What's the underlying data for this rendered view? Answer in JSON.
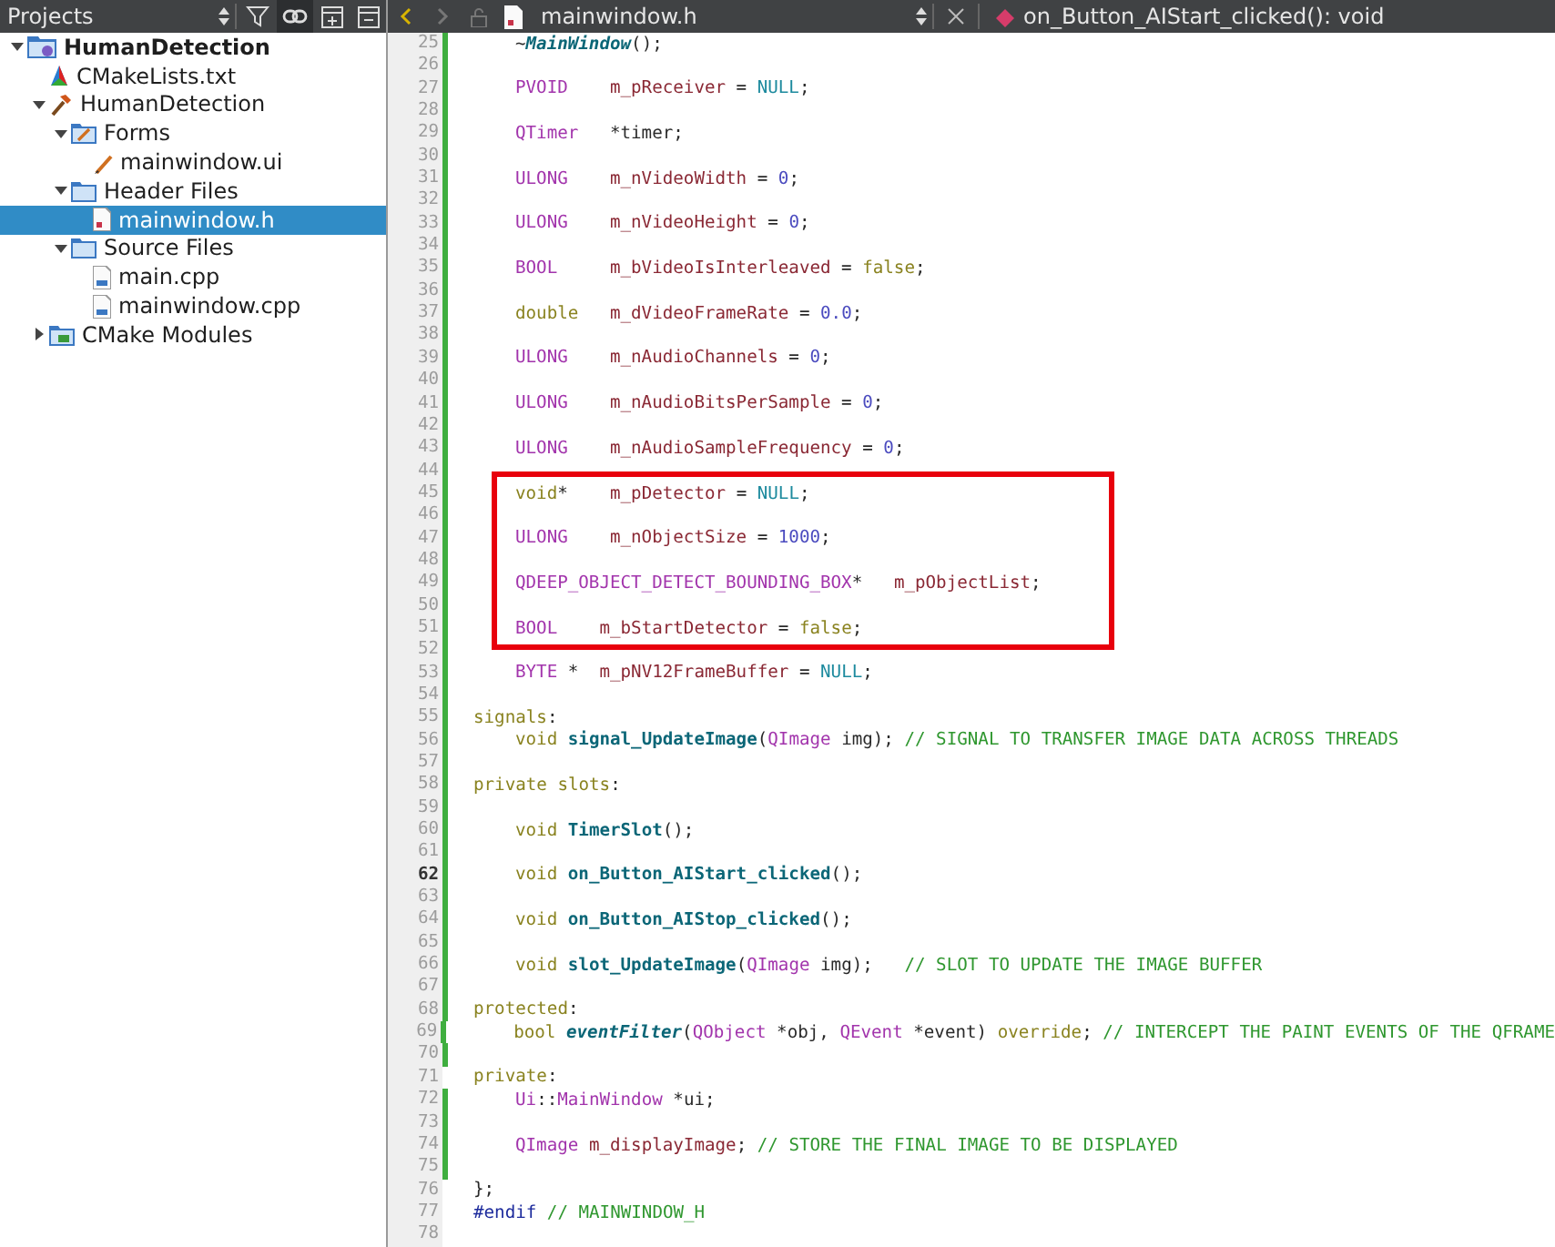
{
  "sidebar": {
    "title": "Projects",
    "tree": [
      {
        "label": "HumanDetection",
        "kind": "project",
        "expanded": true,
        "selected": false,
        "children": [
          {
            "label": "CMakeLists.txt",
            "kind": "cmake",
            "selected": false
          },
          {
            "label": "HumanDetection",
            "kind": "build",
            "expanded": true,
            "selected": false,
            "children": [
              {
                "label": "Forms",
                "kind": "forms-folder",
                "expanded": true,
                "selected": false,
                "children": [
                  {
                    "label": "mainwindow.ui",
                    "kind": "form",
                    "selected": false
                  }
                ]
              },
              {
                "label": "Header Files",
                "kind": "header-folder",
                "expanded": true,
                "selected": false,
                "children": [
                  {
                    "label": "mainwindow.h",
                    "kind": "header",
                    "selected": true
                  }
                ]
              },
              {
                "label": "Source Files",
                "kind": "source-folder",
                "expanded": true,
                "selected": false,
                "children": [
                  {
                    "label": "main.cpp",
                    "kind": "source",
                    "selected": false
                  },
                  {
                    "label": "mainwindow.cpp",
                    "kind": "source",
                    "selected": false
                  }
                ]
              }
            ]
          },
          {
            "label": "CMake Modules",
            "kind": "modules-folder",
            "expanded": false,
            "selected": false
          }
        ]
      }
    ]
  },
  "editor": {
    "file_name": "mainwindow.h",
    "symbol": "on_Button_AIStart_clicked(): void",
    "lines": [
      {
        "kind": "body",
        "n": "25",
        "modified": true,
        "current": false,
        "tokens": [
          {
            "text": "~",
            "kind": "plain"
          },
          {
            "text": "MainWindow",
            "kind": "italic"
          },
          {
            "text": "();",
            "kind": "plain"
          }
        ]
      },
      {
        "kind": "blank",
        "n": "26",
        "modified": true,
        "current": false
      },
      {
        "kind": "body",
        "n": "27",
        "modified": true,
        "current": false,
        "tokens": [
          {
            "text": "PVOID    ",
            "kind": "type"
          },
          {
            "text": "m_pReceiver",
            "kind": "member"
          },
          {
            "text": " = ",
            "kind": "plain"
          },
          {
            "text": "NULL",
            "kind": "constant"
          },
          {
            "text": ";",
            "kind": "plain"
          }
        ]
      },
      {
        "kind": "blank",
        "n": "28",
        "modified": true,
        "current": false
      },
      {
        "kind": "body",
        "n": "29",
        "modified": true,
        "current": false,
        "tokens": [
          {
            "text": "QTimer   ",
            "kind": "type"
          },
          {
            "text": "*timer;",
            "kind": "plain"
          }
        ]
      },
      {
        "kind": "blank",
        "n": "30",
        "modified": true,
        "current": false
      },
      {
        "kind": "body",
        "n": "31",
        "modified": true,
        "current": false,
        "tokens": [
          {
            "text": "ULONG    ",
            "kind": "type"
          },
          {
            "text": "m_nVideoWidth",
            "kind": "member"
          },
          {
            "text": " = ",
            "kind": "plain"
          },
          {
            "text": "0",
            "kind": "number"
          },
          {
            "text": ";",
            "kind": "plain"
          }
        ]
      },
      {
        "kind": "blank",
        "n": "32",
        "modified": true,
        "current": false
      },
      {
        "kind": "body",
        "n": "33",
        "modified": true,
        "current": false,
        "tokens": [
          {
            "text": "ULONG    ",
            "kind": "type"
          },
          {
            "text": "m_nVideoHeight",
            "kind": "member"
          },
          {
            "text": " = ",
            "kind": "plain"
          },
          {
            "text": "0",
            "kind": "number"
          },
          {
            "text": ";",
            "kind": "plain"
          }
        ]
      },
      {
        "kind": "blank",
        "n": "34",
        "modified": true,
        "current": false
      },
      {
        "kind": "body",
        "n": "35",
        "modified": true,
        "current": false,
        "tokens": [
          {
            "text": "BOOL     ",
            "kind": "type"
          },
          {
            "text": "m_bVideoIsInterleaved",
            "kind": "member"
          },
          {
            "text": " = ",
            "kind": "plain"
          },
          {
            "text": "false",
            "kind": "keyword"
          },
          {
            "text": ";",
            "kind": "plain"
          }
        ]
      },
      {
        "kind": "blank",
        "n": "36",
        "modified": true,
        "current": false
      },
      {
        "kind": "body",
        "n": "37",
        "modified": true,
        "current": false,
        "tokens": [
          {
            "text": "double   ",
            "kind": "keyword"
          },
          {
            "text": "m_dVideoFrameRate",
            "kind": "member"
          },
          {
            "text": " = ",
            "kind": "plain"
          },
          {
            "text": "0.0",
            "kind": "number"
          },
          {
            "text": ";",
            "kind": "plain"
          }
        ]
      },
      {
        "kind": "blank",
        "n": "38",
        "modified": true,
        "current": false
      },
      {
        "kind": "body",
        "n": "39",
        "modified": true,
        "current": false,
        "tokens": [
          {
            "text": "ULONG    ",
            "kind": "type"
          },
          {
            "text": "m_nAudioChannels",
            "kind": "member"
          },
          {
            "text": " = ",
            "kind": "plain"
          },
          {
            "text": "0",
            "kind": "number"
          },
          {
            "text": ";",
            "kind": "plain"
          }
        ]
      },
      {
        "kind": "blank",
        "n": "40",
        "modified": true,
        "current": false
      },
      {
        "kind": "body",
        "n": "41",
        "modified": true,
        "current": false,
        "tokens": [
          {
            "text": "ULONG    ",
            "kind": "type"
          },
          {
            "text": "m_nAudioBitsPerSample",
            "kind": "member"
          },
          {
            "text": " = ",
            "kind": "plain"
          },
          {
            "text": "0",
            "kind": "number"
          },
          {
            "text": ";",
            "kind": "plain"
          }
        ]
      },
      {
        "kind": "blank",
        "n": "42",
        "modified": true,
        "current": false
      },
      {
        "kind": "body",
        "n": "43",
        "modified": true,
        "current": false,
        "tokens": [
          {
            "text": "ULONG    ",
            "kind": "type"
          },
          {
            "text": "m_nAudioSampleFrequency",
            "kind": "member"
          },
          {
            "text": " = ",
            "kind": "plain"
          },
          {
            "text": "0",
            "kind": "number"
          },
          {
            "text": ";",
            "kind": "plain"
          }
        ]
      },
      {
        "kind": "blank",
        "n": "44",
        "modified": true,
        "current": false
      },
      {
        "kind": "highlight",
        "children": [
          {
            "kind": "body",
            "n": "45",
            "modified": true,
            "current": false,
            "tokens": [
              {
                "text": "void",
                "kind": "keyword"
              },
              {
                "text": "*    ",
                "kind": "plain"
              },
              {
                "text": "m_pDetector",
                "kind": "member"
              },
              {
                "text": " = ",
                "kind": "plain"
              },
              {
                "text": "NULL",
                "kind": "constant"
              },
              {
                "text": ";",
                "kind": "plain"
              }
            ]
          },
          {
            "kind": "blank",
            "n": "46",
            "modified": true,
            "current": false
          },
          {
            "kind": "body",
            "n": "47",
            "modified": true,
            "current": false,
            "tokens": [
              {
                "text": "ULONG    ",
                "kind": "type"
              },
              {
                "text": "m_nObjectSize",
                "kind": "member"
              },
              {
                "text": " = ",
                "kind": "plain"
              },
              {
                "text": "1000",
                "kind": "number"
              },
              {
                "text": ";",
                "kind": "plain"
              }
            ]
          },
          {
            "kind": "blank",
            "n": "48",
            "modified": true,
            "current": false
          },
          {
            "kind": "body",
            "n": "49",
            "modified": true,
            "current": false,
            "tokens": [
              {
                "text": "QDEEP_OBJECT_DETECT_BOUNDING_BOX",
                "kind": "type"
              },
              {
                "text": "*   ",
                "kind": "plain"
              },
              {
                "text": "m_pObjectList",
                "kind": "member"
              },
              {
                "text": ";",
                "kind": "plain"
              }
            ]
          },
          {
            "kind": "blank",
            "n": "50",
            "modified": true,
            "current": false
          },
          {
            "kind": "body",
            "n": "51",
            "modified": true,
            "current": false,
            "tokens": [
              {
                "text": "BOOL    ",
                "kind": "type"
              },
              {
                "text": "m_bStartDetector",
                "kind": "member"
              },
              {
                "text": " = ",
                "kind": "plain"
              },
              {
                "text": "false",
                "kind": "keyword"
              },
              {
                "text": ";",
                "kind": "plain"
              }
            ]
          }
        ]
      },
      {
        "kind": "blank",
        "n": "52",
        "modified": true,
        "current": false
      },
      {
        "kind": "body",
        "n": "53",
        "modified": true,
        "current": false,
        "tokens": [
          {
            "text": "BYTE ",
            "kind": "type"
          },
          {
            "text": "*  ",
            "kind": "plain"
          },
          {
            "text": "m_pNV12FrameBuffer",
            "kind": "member"
          },
          {
            "text": " = ",
            "kind": "plain"
          },
          {
            "text": "NULL",
            "kind": "constant"
          },
          {
            "text": ";",
            "kind": "plain"
          }
        ]
      },
      {
        "kind": "blank",
        "n": "54",
        "modified": true,
        "current": false
      },
      {
        "kind": "label",
        "n": "55",
        "modified": true,
        "current": false,
        "tokens": [
          {
            "text": "signals",
            "kind": "keyword"
          },
          {
            "text": ":",
            "kind": "plain"
          }
        ]
      },
      {
        "kind": "body",
        "n": "56",
        "modified": true,
        "current": false,
        "tokens": [
          {
            "text": "void ",
            "kind": "keyword"
          },
          {
            "text": "signal_UpdateImage",
            "kind": "function"
          },
          {
            "text": "(",
            "kind": "plain"
          },
          {
            "text": "QImage",
            "kind": "type"
          },
          {
            "text": " img); ",
            "kind": "plain"
          },
          {
            "text": "// SIGNAL TO TRANSFER IMAGE DATA ACROSS THREADS",
            "kind": "comment"
          }
        ]
      },
      {
        "kind": "blank",
        "n": "57",
        "modified": true,
        "current": false
      },
      {
        "kind": "label",
        "n": "58",
        "modified": true,
        "current": false,
        "tokens": [
          {
            "text": "private slots",
            "kind": "keyword"
          },
          {
            "text": ":",
            "kind": "plain"
          }
        ]
      },
      {
        "kind": "blank",
        "n": "59",
        "modified": true,
        "current": false
      },
      {
        "kind": "body",
        "n": "60",
        "modified": true,
        "current": false,
        "tokens": [
          {
            "text": "void ",
            "kind": "keyword"
          },
          {
            "text": "TimerSlot",
            "kind": "function"
          },
          {
            "text": "();",
            "kind": "plain"
          }
        ]
      },
      {
        "kind": "blank",
        "n": "61",
        "modified": true,
        "current": false
      },
      {
        "kind": "body",
        "n": "62",
        "modified": true,
        "current": true,
        "tokens": [
          {
            "text": "void ",
            "kind": "keyword"
          },
          {
            "text": "on_Button_AIStart_clicked",
            "kind": "function"
          },
          {
            "text": "();",
            "kind": "plain"
          }
        ]
      },
      {
        "kind": "blank",
        "n": "63",
        "modified": true,
        "current": false
      },
      {
        "kind": "body",
        "n": "64",
        "modified": true,
        "current": false,
        "tokens": [
          {
            "text": "void ",
            "kind": "keyword"
          },
          {
            "text": "on_Button_AIStop_clicked",
            "kind": "function"
          },
          {
            "text": "();",
            "kind": "plain"
          }
        ]
      },
      {
        "kind": "blank",
        "n": "65",
        "modified": true,
        "current": false
      },
      {
        "kind": "body",
        "n": "66",
        "modified": true,
        "current": false,
        "tokens": [
          {
            "text": "void ",
            "kind": "keyword"
          },
          {
            "text": "slot_UpdateImage",
            "kind": "function"
          },
          {
            "text": "(",
            "kind": "plain"
          },
          {
            "text": "QImage",
            "kind": "type"
          },
          {
            "text": " img);   ",
            "kind": "plain"
          },
          {
            "text": "// SLOT TO UPDATE THE IMAGE BUFFER",
            "kind": "comment"
          }
        ]
      },
      {
        "kind": "blank",
        "n": "67",
        "modified": true,
        "current": false
      },
      {
        "kind": "label",
        "n": "68",
        "modified": true,
        "current": false,
        "tokens": [
          {
            "text": "protected",
            "kind": "keyword"
          },
          {
            "text": ":",
            "kind": "plain"
          }
        ]
      },
      {
        "kind": "body",
        "n": "69",
        "modified": true,
        "current": false,
        "tokens": [
          {
            "text": "bool ",
            "kind": "keyword"
          },
          {
            "text": "eventFilter",
            "kind": "italic"
          },
          {
            "text": "(",
            "kind": "plain"
          },
          {
            "text": "QObject",
            "kind": "type"
          },
          {
            "text": " *obj, ",
            "kind": "plain"
          },
          {
            "text": "QEvent",
            "kind": "type"
          },
          {
            "text": " *event) ",
            "kind": "plain"
          },
          {
            "text": "override",
            "kind": "keyword"
          },
          {
            "text": "; ",
            "kind": "plain"
          },
          {
            "text": "// INTERCEPT THE PAINT EVENTS OF THE QFRAME",
            "kind": "comment"
          }
        ]
      },
      {
        "kind": "blank",
        "n": "70",
        "modified": true,
        "current": false
      },
      {
        "kind": "label",
        "n": "71",
        "modified": false,
        "current": false,
        "tokens": [
          {
            "text": "private",
            "kind": "keyword"
          },
          {
            "text": ":",
            "kind": "plain"
          }
        ]
      },
      {
        "kind": "body",
        "n": "72",
        "modified": true,
        "current": false,
        "tokens": [
          {
            "text": "Ui",
            "kind": "type"
          },
          {
            "text": "::",
            "kind": "plain"
          },
          {
            "text": "MainWindow",
            "kind": "type"
          },
          {
            "text": " *ui;",
            "kind": "plain"
          }
        ]
      },
      {
        "kind": "blank",
        "n": "73",
        "modified": true,
        "current": false
      },
      {
        "kind": "body",
        "n": "74",
        "modified": true,
        "current": false,
        "tokens": [
          {
            "text": "QImage ",
            "kind": "type"
          },
          {
            "text": "m_displayImage",
            "kind": "member"
          },
          {
            "text": "; ",
            "kind": "plain"
          },
          {
            "text": "// STORE THE FINAL IMAGE TO BE DISPLAYED",
            "kind": "comment"
          }
        ]
      },
      {
        "kind": "blank",
        "n": "75",
        "modified": true,
        "current": false
      },
      {
        "kind": "label",
        "n": "76",
        "modified": false,
        "current": false,
        "tokens": [
          {
            "text": "};",
            "kind": "plain"
          }
        ]
      },
      {
        "kind": "label",
        "n": "77",
        "modified": false,
        "current": false,
        "tokens": [
          {
            "text": "#endif",
            "kind": "preproc"
          },
          {
            "text": " // MAINWINDOW_H",
            "kind": "comment"
          }
        ]
      },
      {
        "kind": "blank",
        "n": "78",
        "modified": false,
        "current": false
      }
    ]
  }
}
